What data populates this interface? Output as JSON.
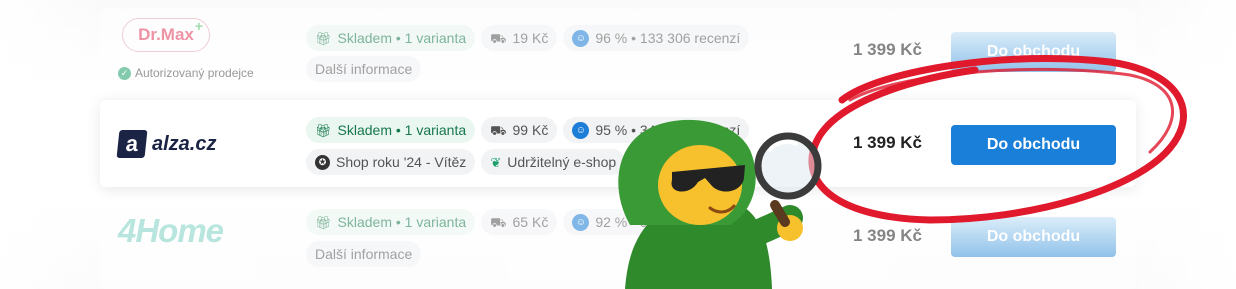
{
  "offers": [
    {
      "shop": "Dr.Max",
      "authorized": "Autorizovaný prodejce",
      "stock": "Skladem • 1 varianta",
      "shipping": "19 Kč",
      "rating": "96 % • 133 306 recenzí",
      "extra": [
        "Další informace"
      ],
      "price": "1 399 Kč",
      "cta": "Do obchodu"
    },
    {
      "shop": "alza.cz",
      "stock": "Skladem • 1 varianta",
      "shipping": "99 Kč",
      "rating": "95 % • 347 537 recenzí",
      "extra": [
        "Shop roku '24 - Vítěz",
        "Udržitelný e-shop"
      ],
      "price": "1 399 Kč",
      "cta": "Do obchodu"
    },
    {
      "shop": "4Home",
      "stock": "Skladem • 1 varianta",
      "shipping": "65 Kč",
      "rating": "92 % • 99 ",
      "extra": [
        "Další informace"
      ],
      "price": "1 399 Kč",
      "cta": "Do obchodu"
    }
  ],
  "colors": {
    "accent": "#1a7fd8",
    "stock_green": "#15784c",
    "highlight_circle": "#e0192d"
  },
  "icons": {
    "stock": "gift-box-icon",
    "shipping": "truck-icon",
    "rating": "shop-rating-icon",
    "award": "award-icon",
    "eco": "leaf-icon",
    "authorized": "check-circle-icon"
  }
}
